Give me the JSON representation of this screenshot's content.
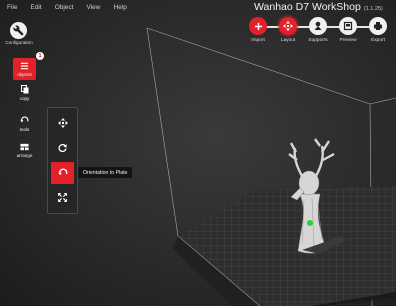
{
  "menu": [
    "File",
    "Edit",
    "Object",
    "View",
    "Help"
  ],
  "app": {
    "title": "Wanhao D7 WorkShop",
    "version": "(1.1.25)"
  },
  "config": {
    "label": "Configuration"
  },
  "toolbar": {
    "steps": [
      {
        "label": "Import",
        "icon": "plus-icon",
        "active": false
      },
      {
        "label": "Layout",
        "icon": "move-arrows-icon",
        "active": true
      },
      {
        "label": "Supports",
        "icon": "supports-icon",
        "active": false
      },
      {
        "label": "Preview",
        "icon": "preview-icon",
        "active": false
      },
      {
        "label": "Export",
        "icon": "printer-icon",
        "active": false
      }
    ]
  },
  "sidebar": {
    "objects": {
      "label": "objects",
      "badge": "1"
    },
    "copy": {
      "label": "copy"
    },
    "tools": {
      "label": "tools"
    },
    "arrange": {
      "label": "arrange"
    }
  },
  "subtools": {
    "items": [
      "move-arrows-icon",
      "rotate-icon",
      "orient-to-plate-icon",
      "scale-icon"
    ],
    "active_index": 2,
    "tooltip": "Orientation to Plate"
  },
  "colors": {
    "accent": "#e3212a",
    "background": "#2a2a2a",
    "model": "#d9d9d9",
    "pivot": "#2bd62b"
  }
}
